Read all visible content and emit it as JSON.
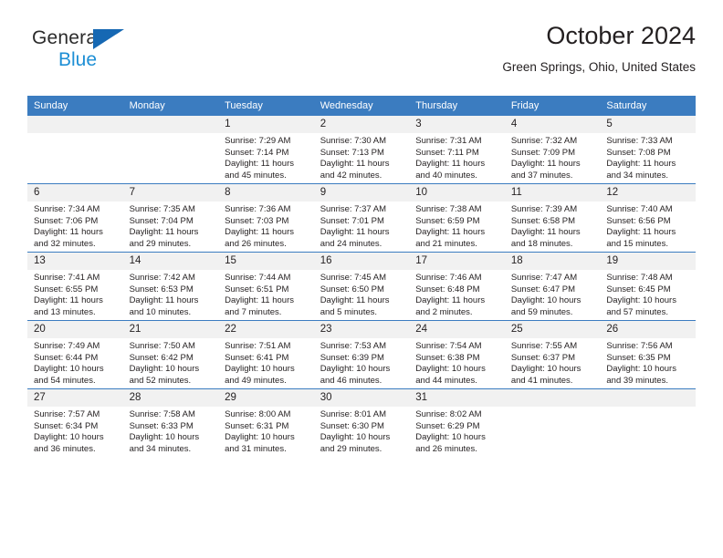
{
  "logo": {
    "word_one": "General",
    "word_two": "Blue",
    "triangle_color": "#1668b3",
    "blue_color": "#1e8fd5"
  },
  "header": {
    "title": "October 2024",
    "subtitle": "Green Springs, Ohio, United States"
  },
  "theme": {
    "header_blue": "#3b7cc0",
    "daynum_band": "#f1f1f1",
    "text": "#231f20"
  },
  "weekday_headers": [
    "Sunday",
    "Monday",
    "Tuesday",
    "Wednesday",
    "Thursday",
    "Friday",
    "Saturday"
  ],
  "weeks": [
    [
      {
        "day": "",
        "sunrise": "",
        "sunset": "",
        "daylight_1": "",
        "daylight_2": ""
      },
      {
        "day": "",
        "sunrise": "",
        "sunset": "",
        "daylight_1": "",
        "daylight_2": ""
      },
      {
        "day": "1",
        "sunrise": "Sunrise: 7:29 AM",
        "sunset": "Sunset: 7:14 PM",
        "daylight_1": "Daylight: 11 hours",
        "daylight_2": "and 45 minutes."
      },
      {
        "day": "2",
        "sunrise": "Sunrise: 7:30 AM",
        "sunset": "Sunset: 7:13 PM",
        "daylight_1": "Daylight: 11 hours",
        "daylight_2": "and 42 minutes."
      },
      {
        "day": "3",
        "sunrise": "Sunrise: 7:31 AM",
        "sunset": "Sunset: 7:11 PM",
        "daylight_1": "Daylight: 11 hours",
        "daylight_2": "and 40 minutes."
      },
      {
        "day": "4",
        "sunrise": "Sunrise: 7:32 AM",
        "sunset": "Sunset: 7:09 PM",
        "daylight_1": "Daylight: 11 hours",
        "daylight_2": "and 37 minutes."
      },
      {
        "day": "5",
        "sunrise": "Sunrise: 7:33 AM",
        "sunset": "Sunset: 7:08 PM",
        "daylight_1": "Daylight: 11 hours",
        "daylight_2": "and 34 minutes."
      }
    ],
    [
      {
        "day": "6",
        "sunrise": "Sunrise: 7:34 AM",
        "sunset": "Sunset: 7:06 PM",
        "daylight_1": "Daylight: 11 hours",
        "daylight_2": "and 32 minutes."
      },
      {
        "day": "7",
        "sunrise": "Sunrise: 7:35 AM",
        "sunset": "Sunset: 7:04 PM",
        "daylight_1": "Daylight: 11 hours",
        "daylight_2": "and 29 minutes."
      },
      {
        "day": "8",
        "sunrise": "Sunrise: 7:36 AM",
        "sunset": "Sunset: 7:03 PM",
        "daylight_1": "Daylight: 11 hours",
        "daylight_2": "and 26 minutes."
      },
      {
        "day": "9",
        "sunrise": "Sunrise: 7:37 AM",
        "sunset": "Sunset: 7:01 PM",
        "daylight_1": "Daylight: 11 hours",
        "daylight_2": "and 24 minutes."
      },
      {
        "day": "10",
        "sunrise": "Sunrise: 7:38 AM",
        "sunset": "Sunset: 6:59 PM",
        "daylight_1": "Daylight: 11 hours",
        "daylight_2": "and 21 minutes."
      },
      {
        "day": "11",
        "sunrise": "Sunrise: 7:39 AM",
        "sunset": "Sunset: 6:58 PM",
        "daylight_1": "Daylight: 11 hours",
        "daylight_2": "and 18 minutes."
      },
      {
        "day": "12",
        "sunrise": "Sunrise: 7:40 AM",
        "sunset": "Sunset: 6:56 PM",
        "daylight_1": "Daylight: 11 hours",
        "daylight_2": "and 15 minutes."
      }
    ],
    [
      {
        "day": "13",
        "sunrise": "Sunrise: 7:41 AM",
        "sunset": "Sunset: 6:55 PM",
        "daylight_1": "Daylight: 11 hours",
        "daylight_2": "and 13 minutes."
      },
      {
        "day": "14",
        "sunrise": "Sunrise: 7:42 AM",
        "sunset": "Sunset: 6:53 PM",
        "daylight_1": "Daylight: 11 hours",
        "daylight_2": "and 10 minutes."
      },
      {
        "day": "15",
        "sunrise": "Sunrise: 7:44 AM",
        "sunset": "Sunset: 6:51 PM",
        "daylight_1": "Daylight: 11 hours",
        "daylight_2": "and 7 minutes."
      },
      {
        "day": "16",
        "sunrise": "Sunrise: 7:45 AM",
        "sunset": "Sunset: 6:50 PM",
        "daylight_1": "Daylight: 11 hours",
        "daylight_2": "and 5 minutes."
      },
      {
        "day": "17",
        "sunrise": "Sunrise: 7:46 AM",
        "sunset": "Sunset: 6:48 PM",
        "daylight_1": "Daylight: 11 hours",
        "daylight_2": "and 2 minutes."
      },
      {
        "day": "18",
        "sunrise": "Sunrise: 7:47 AM",
        "sunset": "Sunset: 6:47 PM",
        "daylight_1": "Daylight: 10 hours",
        "daylight_2": "and 59 minutes."
      },
      {
        "day": "19",
        "sunrise": "Sunrise: 7:48 AM",
        "sunset": "Sunset: 6:45 PM",
        "daylight_1": "Daylight: 10 hours",
        "daylight_2": "and 57 minutes."
      }
    ],
    [
      {
        "day": "20",
        "sunrise": "Sunrise: 7:49 AM",
        "sunset": "Sunset: 6:44 PM",
        "daylight_1": "Daylight: 10 hours",
        "daylight_2": "and 54 minutes."
      },
      {
        "day": "21",
        "sunrise": "Sunrise: 7:50 AM",
        "sunset": "Sunset: 6:42 PM",
        "daylight_1": "Daylight: 10 hours",
        "daylight_2": "and 52 minutes."
      },
      {
        "day": "22",
        "sunrise": "Sunrise: 7:51 AM",
        "sunset": "Sunset: 6:41 PM",
        "daylight_1": "Daylight: 10 hours",
        "daylight_2": "and 49 minutes."
      },
      {
        "day": "23",
        "sunrise": "Sunrise: 7:53 AM",
        "sunset": "Sunset: 6:39 PM",
        "daylight_1": "Daylight: 10 hours",
        "daylight_2": "and 46 minutes."
      },
      {
        "day": "24",
        "sunrise": "Sunrise: 7:54 AM",
        "sunset": "Sunset: 6:38 PM",
        "daylight_1": "Daylight: 10 hours",
        "daylight_2": "and 44 minutes."
      },
      {
        "day": "25",
        "sunrise": "Sunrise: 7:55 AM",
        "sunset": "Sunset: 6:37 PM",
        "daylight_1": "Daylight: 10 hours",
        "daylight_2": "and 41 minutes."
      },
      {
        "day": "26",
        "sunrise": "Sunrise: 7:56 AM",
        "sunset": "Sunset: 6:35 PM",
        "daylight_1": "Daylight: 10 hours",
        "daylight_2": "and 39 minutes."
      }
    ],
    [
      {
        "day": "27",
        "sunrise": "Sunrise: 7:57 AM",
        "sunset": "Sunset: 6:34 PM",
        "daylight_1": "Daylight: 10 hours",
        "daylight_2": "and 36 minutes."
      },
      {
        "day": "28",
        "sunrise": "Sunrise: 7:58 AM",
        "sunset": "Sunset: 6:33 PM",
        "daylight_1": "Daylight: 10 hours",
        "daylight_2": "and 34 minutes."
      },
      {
        "day": "29",
        "sunrise": "Sunrise: 8:00 AM",
        "sunset": "Sunset: 6:31 PM",
        "daylight_1": "Daylight: 10 hours",
        "daylight_2": "and 31 minutes."
      },
      {
        "day": "30",
        "sunrise": "Sunrise: 8:01 AM",
        "sunset": "Sunset: 6:30 PM",
        "daylight_1": "Daylight: 10 hours",
        "daylight_2": "and 29 minutes."
      },
      {
        "day": "31",
        "sunrise": "Sunrise: 8:02 AM",
        "sunset": "Sunset: 6:29 PM",
        "daylight_1": "Daylight: 10 hours",
        "daylight_2": "and 26 minutes."
      },
      {
        "day": "",
        "sunrise": "",
        "sunset": "",
        "daylight_1": "",
        "daylight_2": ""
      },
      {
        "day": "",
        "sunrise": "",
        "sunset": "",
        "daylight_1": "",
        "daylight_2": ""
      }
    ]
  ]
}
